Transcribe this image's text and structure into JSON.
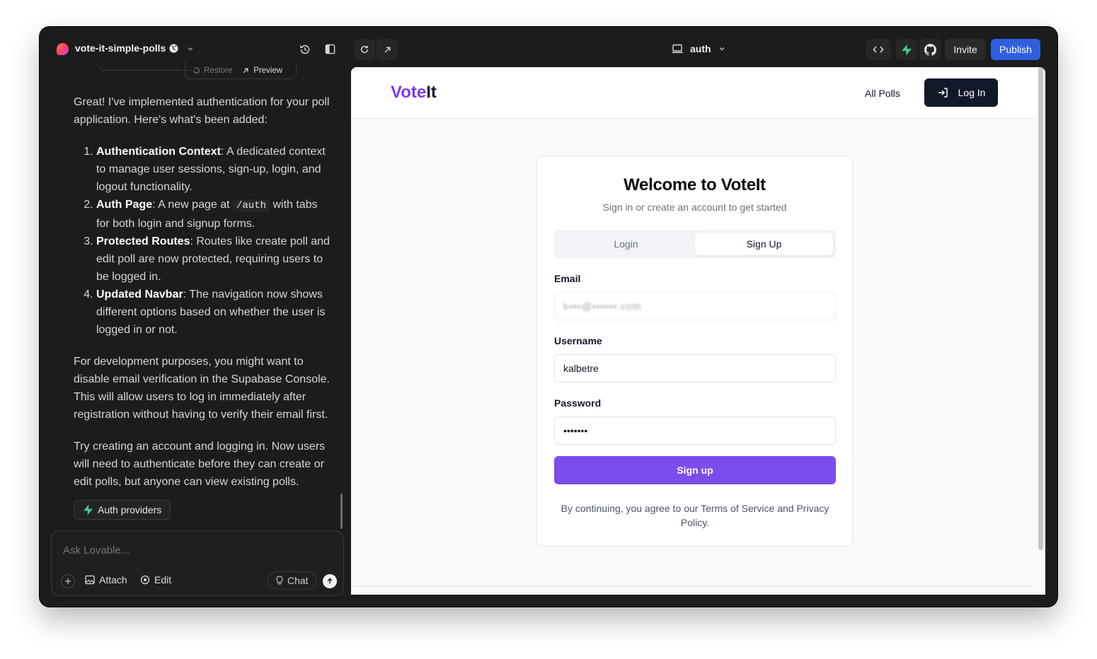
{
  "topbar": {
    "project_name": "vote-it-simple-polls",
    "route": "auth",
    "invite_label": "Invite",
    "publish_label": "Publish"
  },
  "chat": {
    "restore_label": "Restore",
    "preview_label": "Preview",
    "intro": "Great! I've implemented authentication for your poll application. Here's what's been added:",
    "items": [
      {
        "title": "Authentication Context",
        "text": ": A dedicated context to manage user sessions, sign-up, login, and logout functionality."
      },
      {
        "title": "Auth Page",
        "text_before": ": A new page at ",
        "code": "/auth",
        "text_after": " with tabs for both login and signup forms."
      },
      {
        "title": "Protected Routes",
        "text": ": Routes like create poll and edit poll are now protected, requiring users to be logged in."
      },
      {
        "title": "Updated Navbar",
        "text": ": The navigation now shows different options based on whether the user is logged in or not."
      }
    ],
    "para2": "For development purposes, you might want to disable email verification in the Supabase Console. This will allow users to log in immediately after registration without having to verify their email first.",
    "para3": "Try creating an account and logging in. Now users will need to authenticate before they can create or edit polls, but anyone can view existing polls.",
    "auth_providers_label": "Auth providers",
    "composer": {
      "placeholder": "Ask Lovable...",
      "attach_label": "Attach",
      "edit_label": "Edit",
      "chat_label": "Chat"
    }
  },
  "preview": {
    "brand_part1": "Vote",
    "brand_part2": "It",
    "nav_all_polls": "All Polls",
    "nav_login": "Log In",
    "card": {
      "title": "Welcome to VoteIt",
      "subtitle": "Sign in or create an account to get started",
      "tab_login": "Login",
      "tab_signup": "Sign Up",
      "email_label": "Email",
      "email_value": "k•••@••••••.com",
      "username_label": "Username",
      "username_value": "kalbetre",
      "password_label": "Password",
      "password_value": "•••••••",
      "submit_label": "Sign up",
      "terms": "By continuing, you agree to our Terms of Service and Privacy Policy."
    }
  },
  "colors": {
    "accent_purple": "#7c3aed",
    "publish_blue": "#2f5fe0",
    "supabase_green": "#3ecf8e"
  }
}
